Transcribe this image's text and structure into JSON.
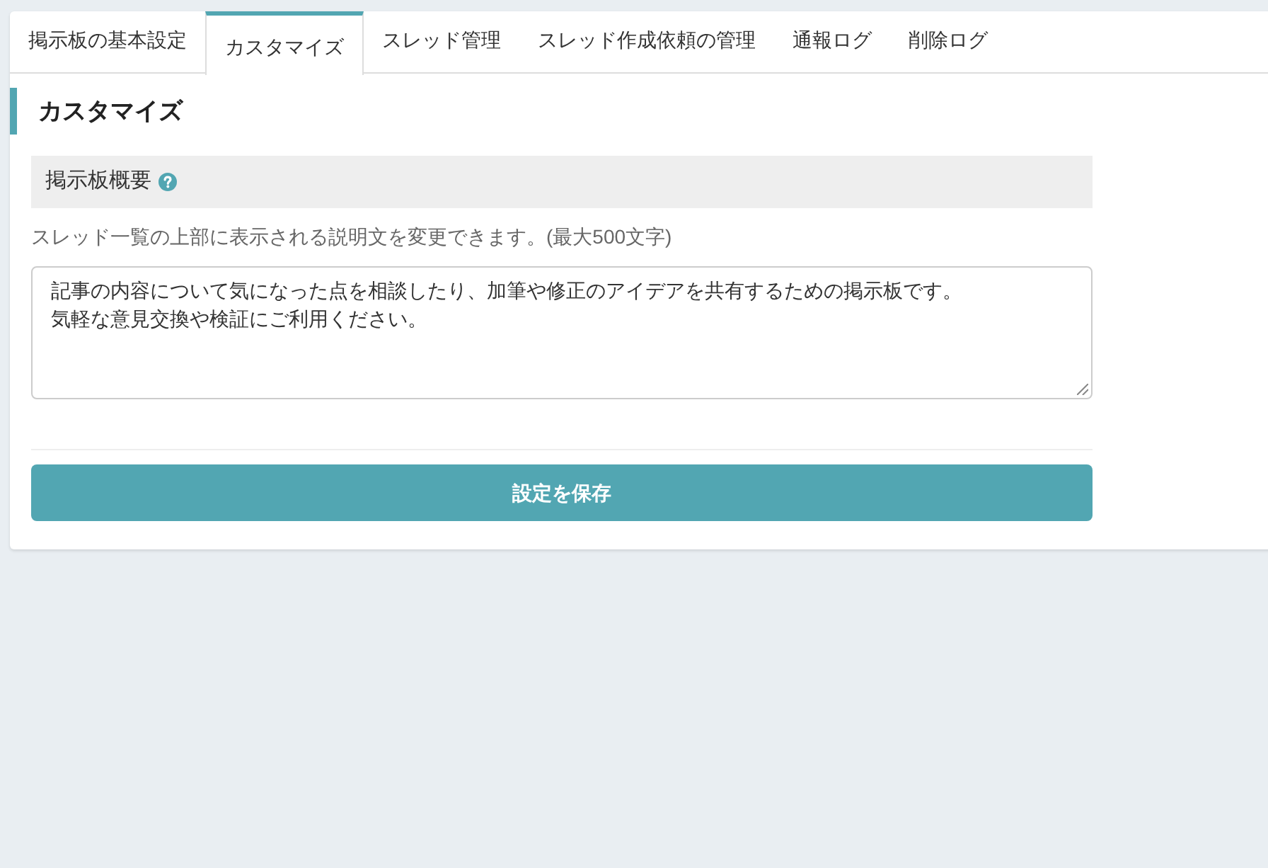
{
  "tabs": [
    {
      "label": "掲示板の基本設定",
      "selected": false
    },
    {
      "label": "カスタマイズ",
      "selected": true
    },
    {
      "label": "スレッド管理",
      "selected": false
    },
    {
      "label": "スレッド作成依頼の管理",
      "selected": false
    },
    {
      "label": "通報ログ",
      "selected": false
    },
    {
      "label": "削除ログ",
      "selected": false
    }
  ],
  "page_title": "カスタマイズ",
  "section": {
    "title": "掲示板概要",
    "description": "スレッド一覧の上部に表示される説明文を変更できます。(最大500文字)",
    "textarea": {
      "lines": [
        "記事の内容について気になった点を相談したり、加筆や修正のアイデアを共有するための掲示板です。",
        "気軽な意見交換や検証にご利用ください。"
      ]
    }
  },
  "save_button": "設定を保存"
}
